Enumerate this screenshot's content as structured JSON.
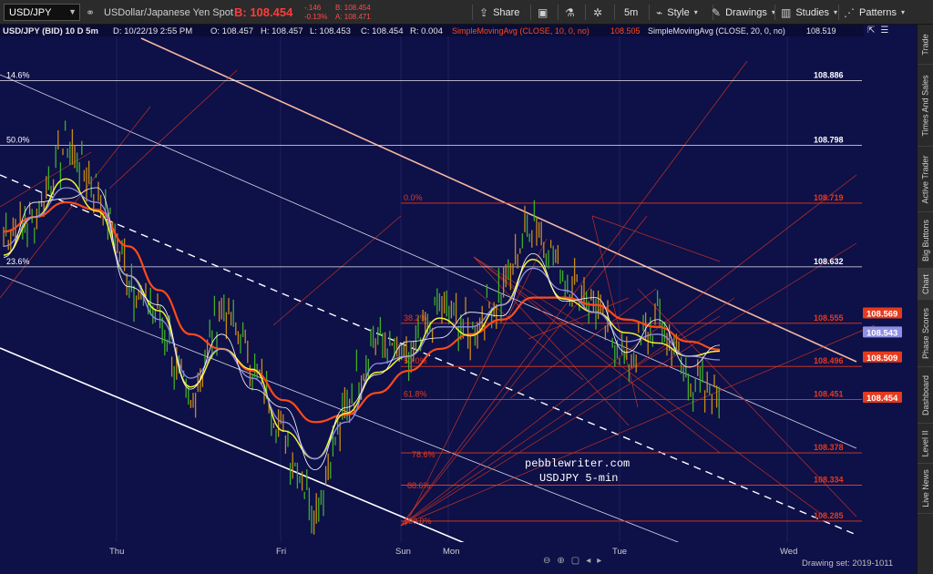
{
  "toolbar": {
    "symbol": "USD/JPY",
    "description": "USDollar/Japanese Yen Spot",
    "bid_big": "B: 108.454",
    "change": "-.146",
    "change_pct": "-0.13%",
    "bid_small": "B: 108.454",
    "ask_small": "A: 108.471",
    "share": "Share",
    "timeframe": "5m",
    "style": "Style",
    "drawings": "Drawings",
    "studies": "Studies",
    "patterns": "Patterns"
  },
  "header": {
    "title": "USD/JPY (BID) 10 D 5m",
    "date": "D: 10/22/19 2:55 PM",
    "open": "O: 108.457",
    "high": "H: 108.457",
    "low": "L: 108.453",
    "close": "C: 108.454",
    "range": "R: 0.004",
    "sma10": "SimpleMovingAvg (CLOSE, 10, 0, no)",
    "sma10_val": "108.505",
    "sma20": "SimpleMovingAvg (CLOSE, 20, 0, no)",
    "sma20_val": "108.519"
  },
  "levels": [
    {
      "pct": "14.6%",
      "price": "108.886",
      "y": 108.886,
      "kind": "white"
    },
    {
      "pct": "50.0%",
      "price": "108.798",
      "y": 108.798,
      "kind": "white"
    },
    {
      "pct": "0.0%",
      "price": "108.719",
      "y": 108.719,
      "kind": "red"
    },
    {
      "pct": "23.6%",
      "price": "108.632",
      "y": 108.632,
      "kind": "white"
    },
    {
      "pct": "38.2%",
      "price": "108.555",
      "y": 108.555,
      "kind": "red"
    },
    {
      "pct": "50.0%",
      "price": "108.496",
      "y": 108.496,
      "kind": "red"
    },
    {
      "pct": "61.8%",
      "price": "108.451",
      "y": 108.451,
      "kind": "red"
    },
    {
      "pct": "",
      "price": "108.378",
      "y": 108.378,
      "kind": "red"
    },
    {
      "pct": "",
      "price": "108.334",
      "y": 108.334,
      "kind": "red"
    },
    {
      "pct": "",
      "price": "108.285",
      "y": 108.285,
      "kind": "red"
    }
  ],
  "extra_fib_labels": [
    "78.6%",
    "88.6%",
    "100.0%"
  ],
  "price_tags": [
    {
      "value": "108.569",
      "color": "#e53a1d"
    },
    {
      "value": "108.543",
      "color": "#8f8fe6"
    },
    {
      "value": "108.509",
      "color": "#e53a1d"
    },
    {
      "value": "108.454",
      "color": "#e53a1d"
    }
  ],
  "x_axis": [
    "Thu",
    "Fri",
    "Sun",
    "Mon",
    "Tue",
    "Wed"
  ],
  "watermark": [
    "pebblewriter.com",
    "USDJPY 5-min"
  ],
  "drawing_set": "Drawing set: 2019-1011",
  "right_tabs": [
    "Trade",
    "Times And Sales",
    "Active Trader",
    "Big Buttons",
    "Chart",
    "Phase Scores",
    "Dashboard",
    "Level II",
    "Live News"
  ],
  "colors": {
    "chart_bg": "#0e1048",
    "price_up": "#3fae2a",
    "price_down": "#c98a1a",
    "sma_red": "#ff4a1a",
    "sma_yellow": "#f2f230",
    "sma_blue": "#8f8fe6",
    "fib_red": "#e53a1d"
  },
  "chart_data": {
    "type": "line",
    "title": "USD/JPY (BID) 10 D 5m",
    "x": [
      "Thu",
      "Fri",
      "Sun",
      "Mon",
      "Tue",
      "Wed"
    ],
    "ylim": [
      108.26,
      108.98
    ],
    "series": [
      {
        "name": "USD/JPY close",
        "values": [
          108.68,
          108.7,
          108.8,
          108.74,
          108.62,
          108.56,
          108.44,
          108.58,
          108.5,
          108.4,
          108.3,
          108.44,
          108.54,
          108.5,
          108.58,
          108.54,
          108.6,
          108.7,
          108.62,
          108.58,
          108.5,
          108.56,
          108.48,
          108.45
        ]
      },
      {
        "name": "SimpleMovingAvg (CLOSE, 10, 0, no)",
        "values": [
          108.66,
          108.7,
          108.74,
          108.72,
          108.62,
          108.56,
          108.48,
          108.52,
          108.48,
          108.42,
          108.37,
          108.42,
          108.5,
          108.51,
          108.55,
          108.55,
          108.58,
          108.63,
          108.6,
          108.57,
          108.53,
          108.54,
          108.51,
          108.505
        ]
      },
      {
        "name": "SimpleMovingAvg (CLOSE, 20, 0, no)",
        "values": [
          108.68,
          108.7,
          108.72,
          108.71,
          108.66,
          108.6,
          108.54,
          108.52,
          108.49,
          108.45,
          108.42,
          108.43,
          108.46,
          108.49,
          108.52,
          108.54,
          108.56,
          108.59,
          108.59,
          108.58,
          108.56,
          108.55,
          108.53,
          108.519
        ]
      }
    ]
  }
}
